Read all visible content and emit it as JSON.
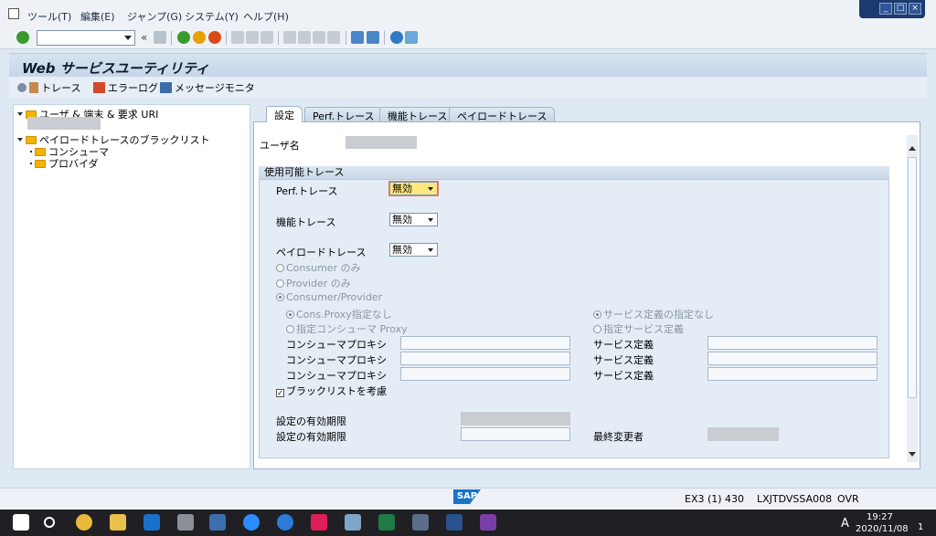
{
  "menu": {
    "items": [
      "ツール(T)",
      "編集(E)",
      "ジャンプ(G)",
      "システム(Y)",
      "ヘルプ(H)"
    ]
  },
  "window_controls": [
    "_",
    "□",
    "×"
  ],
  "toolbar": {
    "back_glyph": "«"
  },
  "app": {
    "title": "Web サービスユーティリティ",
    "buttons": [
      "トレース",
      "エラーログ",
      "メッセージモニタ"
    ]
  },
  "tree": {
    "items": [
      {
        "label": "ユーザ & 端末 & 要求 URI",
        "level": 0
      },
      {
        "label": "ペイロードトレースのブラックリスト",
        "level": 0
      },
      {
        "label": "コンシューマ",
        "level": 1
      },
      {
        "label": "プロバイダ",
        "level": 1
      }
    ]
  },
  "tabs": [
    "設定",
    "Perf.トレース",
    "機能トレース",
    "ペイロードトレース"
  ],
  "form": {
    "user_label": "ユーザ名",
    "group_title": "使用可能トレース",
    "perf_label": "Perf.トレース",
    "perf_value": "無効",
    "func_label": "機能トレース",
    "func_value": "無効",
    "payload_label": "ペイロードトレース",
    "payload_value": "無効",
    "radio_consumer": "Consumer のみ",
    "radio_provider": "Provider のみ",
    "radio_both": "Consumer/Provider",
    "radio_cons_none": "Cons.Proxy指定なし",
    "radio_cons_spec": "指定コンシューマ Proxy",
    "radio_svc_none": "サービス定義の指定なし",
    "radio_svc_spec": "指定サービス定義",
    "proxy_label_1": "コンシューマプロキシ",
    "proxy_label_2": "コンシューマプロキシ",
    "proxy_label_3": "コンシューマプロキシ",
    "svc_label_1": "サービス定義",
    "svc_label_2": "サービス定義",
    "svc_label_3": "サービス定義",
    "blacklist_label": "ブラックリストを考慮",
    "blacklist_checked": "✓",
    "expiry_label_1": "設定の有効期限",
    "expiry_label_2": "設定の有効期限",
    "last_changed_label": "最終変更者"
  },
  "status": {
    "sap": "SAP",
    "system": "EX3 (1) 430",
    "host": "LXJTDVSSA008",
    "mode": "OVR"
  },
  "taskbar": {
    "time": "19:27",
    "date": "2020/11/08",
    "ime": "A",
    "notif_count": "1"
  }
}
